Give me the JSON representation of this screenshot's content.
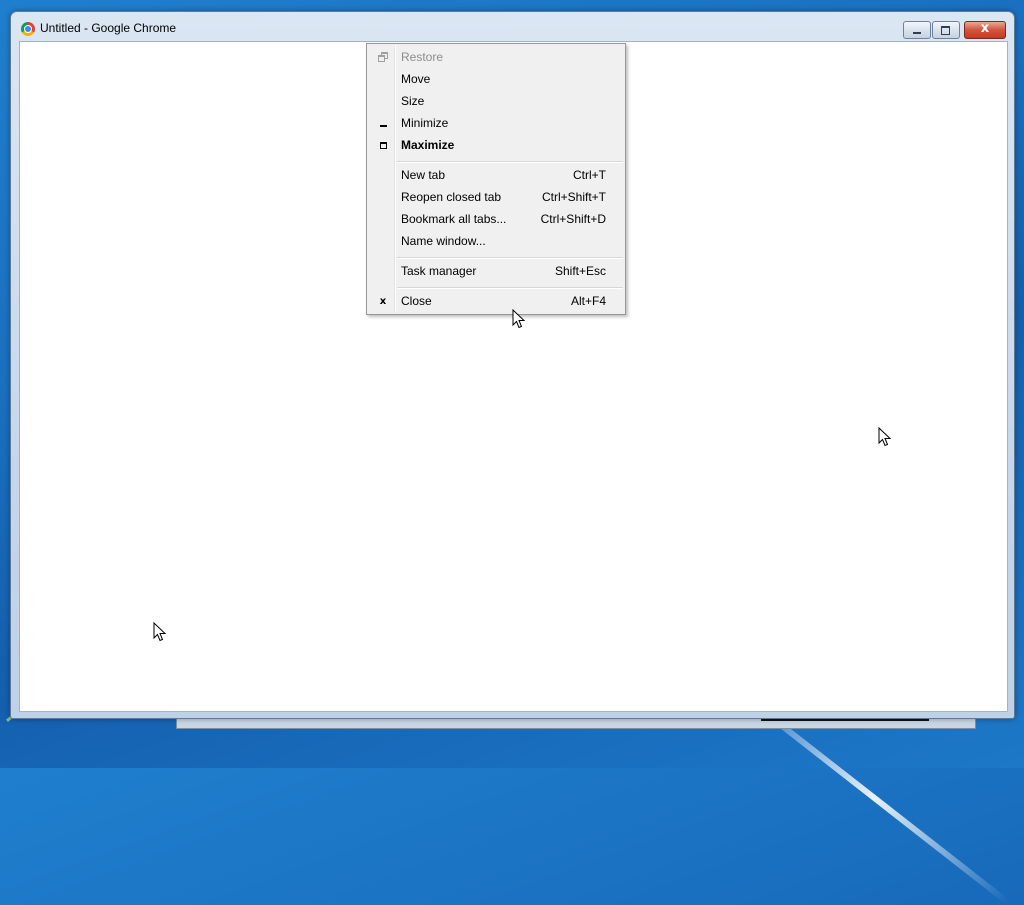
{
  "window": {
    "title": "Untitled - Google Chrome",
    "close_glyph": "x"
  },
  "system_menu": {
    "items": [
      {
        "label": "Restore",
        "accel": "",
        "icon": "restore-icon",
        "state": "disabled"
      },
      {
        "label": "Move",
        "accel": "",
        "icon": "",
        "state": "normal"
      },
      {
        "label": "Size",
        "accel": "",
        "icon": "",
        "state": "normal"
      },
      {
        "label": "Minimize",
        "accel": "",
        "icon": "minimize-icon",
        "state": "normal"
      },
      {
        "label": "Maximize",
        "accel": "",
        "icon": "maximize-icon",
        "state": "default-bold"
      },
      {
        "label": "New tab",
        "accel": "Ctrl+T",
        "icon": "",
        "state": "normal"
      },
      {
        "label": "Reopen closed tab",
        "accel": "Ctrl+Shift+T",
        "icon": "",
        "state": "normal"
      },
      {
        "label": "Bookmark all tabs...",
        "accel": "Ctrl+Shift+D",
        "icon": "",
        "state": "normal"
      },
      {
        "label": "Name window...",
        "accel": "",
        "icon": "",
        "state": "normal"
      },
      {
        "label": "Task manager",
        "accel": "Shift+Esc",
        "icon": "",
        "state": "normal"
      },
      {
        "label": "Close",
        "accel": "Alt+F4",
        "icon": "close-icon",
        "state": "normal"
      }
    ],
    "close_icon_glyph": "x"
  },
  "colors": {
    "desktop": "#1a6fbf",
    "menu_bg": "#f0f0f0",
    "disabled_text": "#8d8d8d",
    "close_button": "#c33b22"
  }
}
